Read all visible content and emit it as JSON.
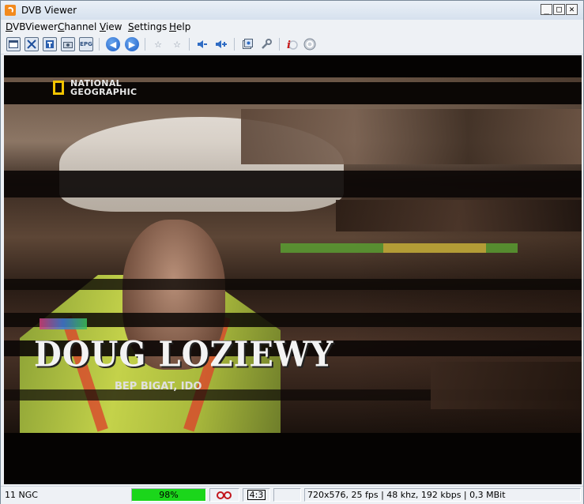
{
  "window": {
    "title": "DVB Viewer"
  },
  "menu": [
    {
      "label": "DVBViewer",
      "accel": "D"
    },
    {
      "label": "Channel",
      "accel": "C"
    },
    {
      "label": "View",
      "accel": "V"
    },
    {
      "label": "Settings",
      "accel": "S"
    },
    {
      "label": "Help",
      "accel": "H"
    }
  ],
  "toolbar": {
    "epg_label": "EPG",
    "buttons": [
      "window-mode-icon",
      "fullscreen-icon",
      "teletext-icon",
      "snapshot-icon",
      "epg-icon",
      "back-icon",
      "forward-icon",
      "favorite-icon",
      "favorite-add-icon",
      "volume-down-icon",
      "volume-up-icon",
      "record-icon",
      "settings-icon",
      "info-icon",
      "power-icon"
    ]
  },
  "video": {
    "channel_logo": "NATIONAL GEOGRAPHIC",
    "lower_third_name": "DOUG LOZIEWY",
    "lower_third_sub": "BEP BIGAT, IDO"
  },
  "status": {
    "channel": "11 NGC",
    "signal": "98%",
    "signal_level": 0.98,
    "aspect": "4:3",
    "stream_info": "720x576, 25 fps | 48 khz, 192 kbps | 0,3 MBit"
  },
  "colors": {
    "signal_bar": "#1bd61b",
    "dolby": "#c2161c",
    "logo_frame": "#f2c400"
  }
}
